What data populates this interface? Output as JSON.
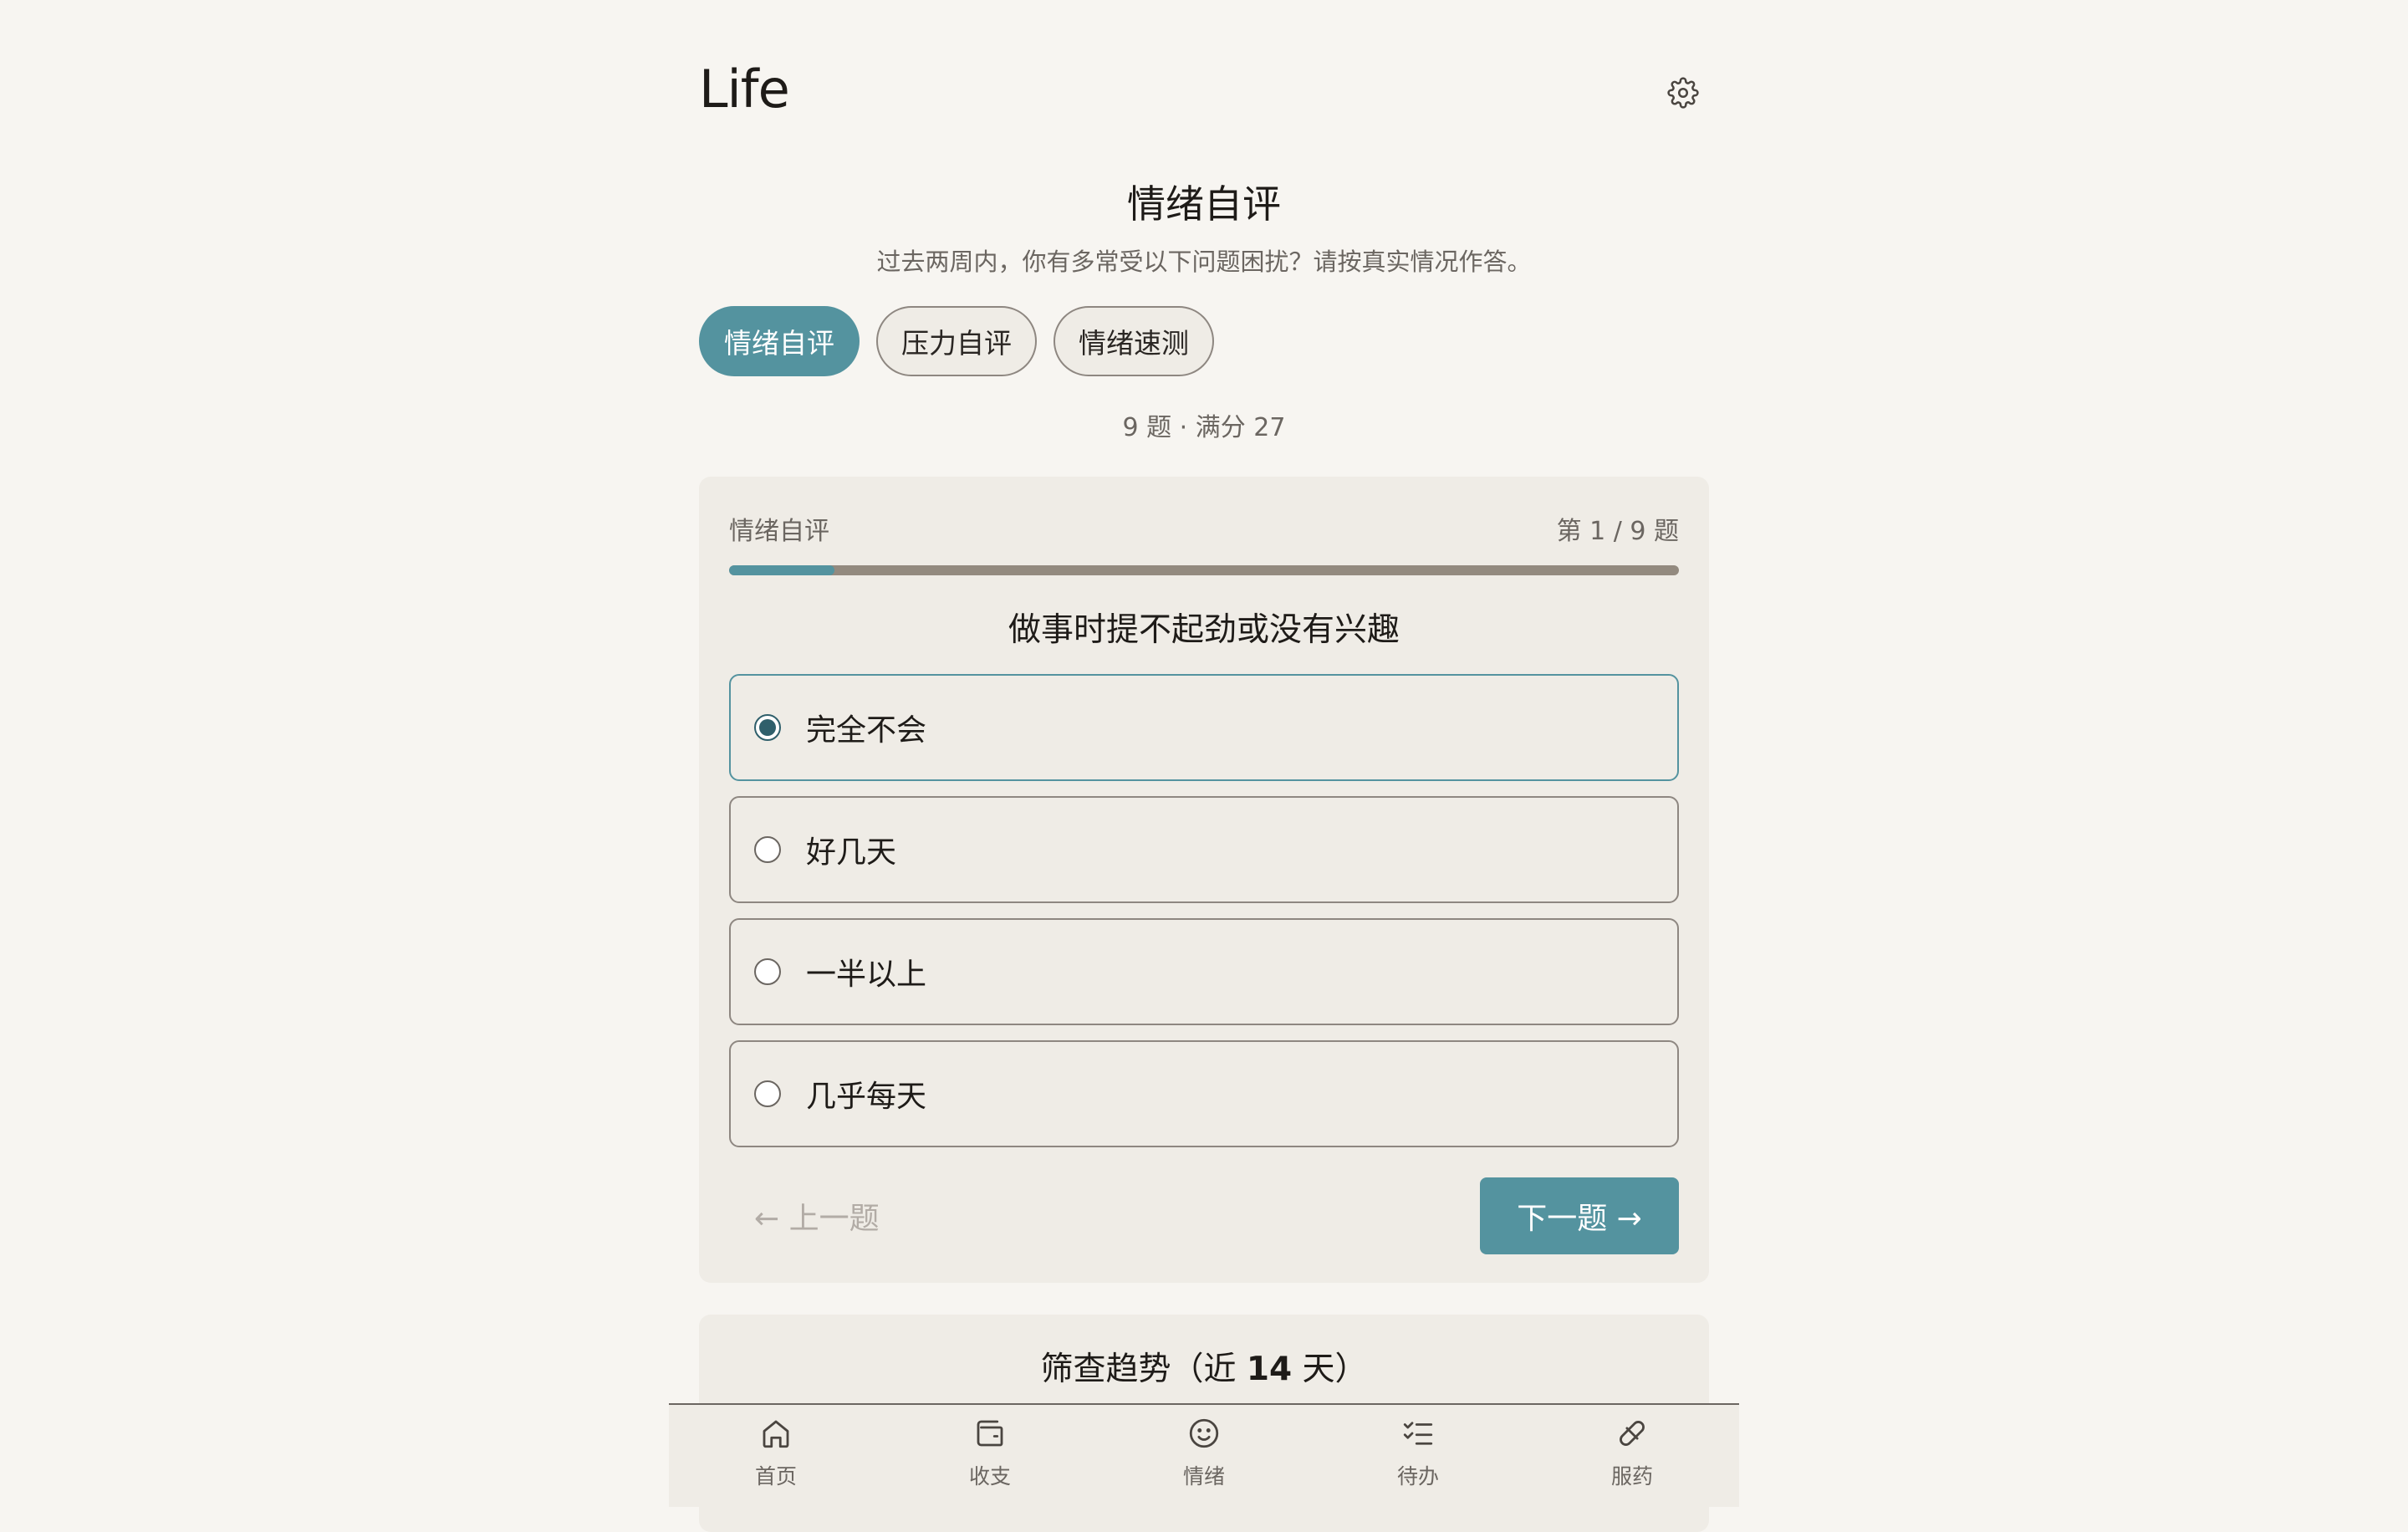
{
  "app": {
    "title": "Life"
  },
  "header": {
    "settings_icon": "gear-icon"
  },
  "page": {
    "title": "情绪自评",
    "subtitle": "过去两周内，你有多常受以下问题困扰？请按真实情况作答。",
    "meta": "9 题 · 满分 27"
  },
  "tabs": [
    {
      "label": "情绪自评",
      "active": true
    },
    {
      "label": "压力自评",
      "active": false
    },
    {
      "label": "情绪速测",
      "active": false
    }
  ],
  "quiz": {
    "name": "情绪自评",
    "counter": "第 1 / 9 题",
    "progress": 0.111,
    "question": "做事时提不起劲或没有兴趣",
    "options": [
      {
        "label": "完全不会",
        "selected": true
      },
      {
        "label": "好几天",
        "selected": false
      },
      {
        "label": "一半以上",
        "selected": false
      },
      {
        "label": "几乎每天",
        "selected": false
      }
    ],
    "prev_label": "← 上一题",
    "next_label": "下一题 →"
  },
  "trend": {
    "title_prefix": "筛查趋势（近 ",
    "days": "14",
    "title_suffix": " 天）"
  },
  "bottom_nav": [
    {
      "label": "首页",
      "icon": "home-icon"
    },
    {
      "label": "收支",
      "icon": "wallet-icon"
    },
    {
      "label": "情绪",
      "icon": "smile-icon"
    },
    {
      "label": "待办",
      "icon": "checklist-icon"
    },
    {
      "label": "服药",
      "icon": "pill-icon"
    }
  ],
  "colors": {
    "accent": "#54939f",
    "background": "#f7f5f1",
    "card": "#efece6"
  }
}
